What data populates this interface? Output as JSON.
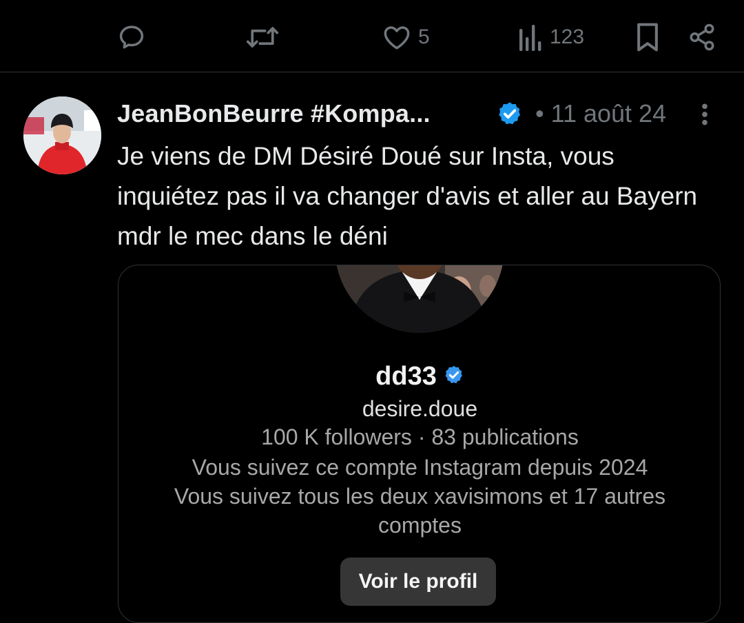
{
  "action_bar": {
    "reply_icon": "reply-bubble-icon",
    "retweet_icon": "retweet-icon",
    "like_icon": "heart-icon",
    "like_count": "5",
    "views_icon": "views-chart-icon",
    "views_count": "123",
    "bookmark_icon": "bookmark-icon",
    "share_icon": "share-icon"
  },
  "tweet": {
    "display_name": "JeanBonBeurre #Kompa...",
    "verified": true,
    "timestamp": "• 11 août 24",
    "text": "Je viens de DM Désiré Doué sur Insta, vous inquiétez pas il va changer d'avis et aller au Bayern mdr le mec dans le déni"
  },
  "card": {
    "name": "dd33",
    "handle": "desire.doue",
    "stats": "100 K followers · 83 publications",
    "follow_since": "Vous suivez ce compte Instagram depuis 2024",
    "mutuals_line1": "Vous suivez tous les deux xavisimons et 17 autres",
    "mutuals_line2": "comptes",
    "button_label": "Voir le profil"
  },
  "colors": {
    "background": "#000000",
    "text_primary": "#e7e9ea",
    "text_secondary": "#71767b",
    "verified_blue": "#1d9bf0",
    "divider": "#2f3336",
    "ig_button": "#363636"
  }
}
